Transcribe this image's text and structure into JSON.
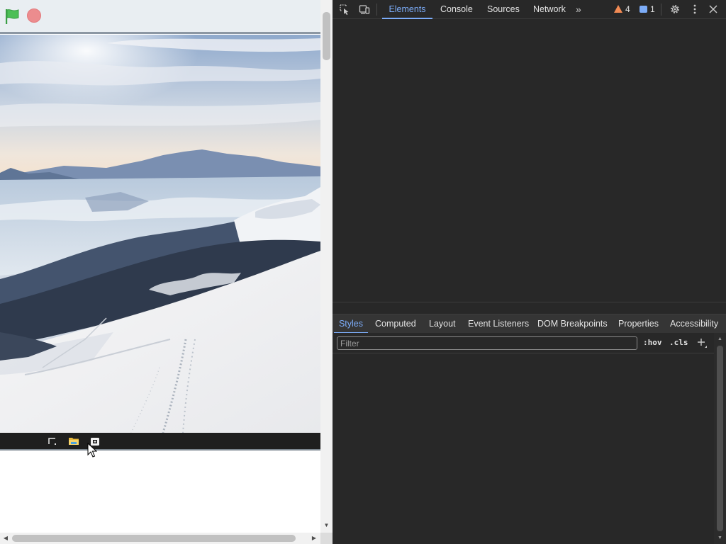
{
  "stage": {
    "flag_icon": "green-flag-icon",
    "stop_icon": "stop-sign-icon",
    "image_subject": "snowy mountain slope with ski tracks above clouds",
    "taskbar_icons": [
      "corner-icon",
      "folder-icon",
      "store-icon"
    ]
  },
  "scroll": {
    "up_arrow": "▲",
    "down_arrow": "▼",
    "left_arrow": "◀",
    "right_arrow": "▶"
  },
  "devtools": {
    "tabs": [
      {
        "label": "Elements",
        "active": true
      },
      {
        "label": "Console",
        "active": false
      },
      {
        "label": "Sources",
        "active": false
      },
      {
        "label": "Network",
        "active": false
      }
    ],
    "more_tabs": "»",
    "warning_count": "4",
    "message_count": "1",
    "sub_tabs": [
      {
        "label": "Styles",
        "active": true
      },
      {
        "label": "Computed",
        "active": false
      },
      {
        "label": "Layout",
        "active": false
      },
      {
        "label": "Event Listeners",
        "active": false
      },
      {
        "label": "DOM Breakpoints",
        "active": false
      },
      {
        "label": "Properties",
        "active": false
      },
      {
        "label": "Accessibility",
        "active": false
      }
    ],
    "styles": {
      "filter_placeholder": "Filter",
      "hov_label": ":hov",
      "cls_label": ".cls"
    }
  },
  "colors": {
    "accent": "#7cacf8",
    "warning": "#f28b54",
    "devtools_bg": "#282828",
    "flag_green": "#4cbf56",
    "stop_red": "#ec8c8e"
  }
}
